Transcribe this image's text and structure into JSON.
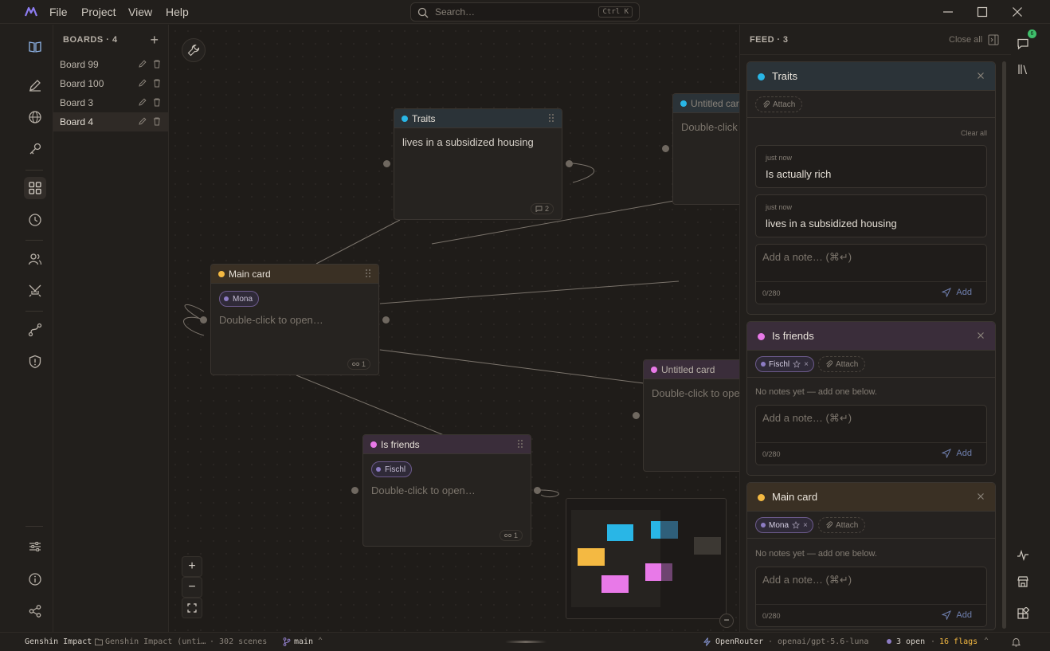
{
  "menu": [
    "File",
    "Project",
    "View",
    "Help"
  ],
  "search": {
    "placeholder": "Search…",
    "shortcut": "Ctrl K"
  },
  "boards": {
    "title": "BOARDS · 4",
    "items": [
      {
        "label": "Board 99"
      },
      {
        "label": "Board 100"
      },
      {
        "label": "Board 3"
      },
      {
        "label": "Board 4"
      }
    ]
  },
  "canvas": {
    "cards": {
      "traits": {
        "title": "Traits",
        "body": "lives in a subsidized housing",
        "badge": "2"
      },
      "untitled1": {
        "title": "Untitled card",
        "body": "Double-click to open…"
      },
      "main": {
        "title": "Main card",
        "chip": "Mona",
        "body": "Double-click to open…",
        "badge": "1"
      },
      "untitled2": {
        "title": "Untitled card",
        "body": "Double-click to open…"
      },
      "friends": {
        "title": "Is friends",
        "chip": "Fischl",
        "body": "Double-click to open…",
        "badge": "1"
      }
    },
    "colors": {
      "traits": "#29b6e6",
      "main": "#f4b942",
      "friends": "#e879e8"
    }
  },
  "feed": {
    "title": "FEED · 3",
    "close_all": "Close all",
    "cards": [
      {
        "title": "Traits",
        "attach": "Attach",
        "clear_all": "Clear all",
        "notes": [
          {
            "time": "just now",
            "text": "Is actually rich"
          },
          {
            "time": "just now",
            "text": "lives in a subsidized housing"
          }
        ],
        "placeholder": "Add a note… (⌘↵)",
        "count": "0/280",
        "add": "Add"
      },
      {
        "title": "Is friends",
        "chip": "Fischl",
        "attach": "Attach",
        "empty": "No notes yet — add one below.",
        "placeholder": "Add a note… (⌘↵)",
        "count": "0/280",
        "add": "Add"
      },
      {
        "title": "Main card",
        "chip": "Mona",
        "attach": "Attach",
        "empty": "No notes yet — add one below.",
        "placeholder": "Add a note… (⌘↵)",
        "count": "0/280",
        "add": "Add"
      }
    ]
  },
  "rail": {
    "notif_count": "6"
  },
  "status": {
    "project": "Genshin Impact",
    "folder": "Genshin Impact (unti…",
    "scenes": "· 302 scenes",
    "branch": "main",
    "provider": "OpenRouter",
    "model": "· openai/gpt-5.6-luna",
    "open": "3 open",
    "flags": "16 flags"
  }
}
